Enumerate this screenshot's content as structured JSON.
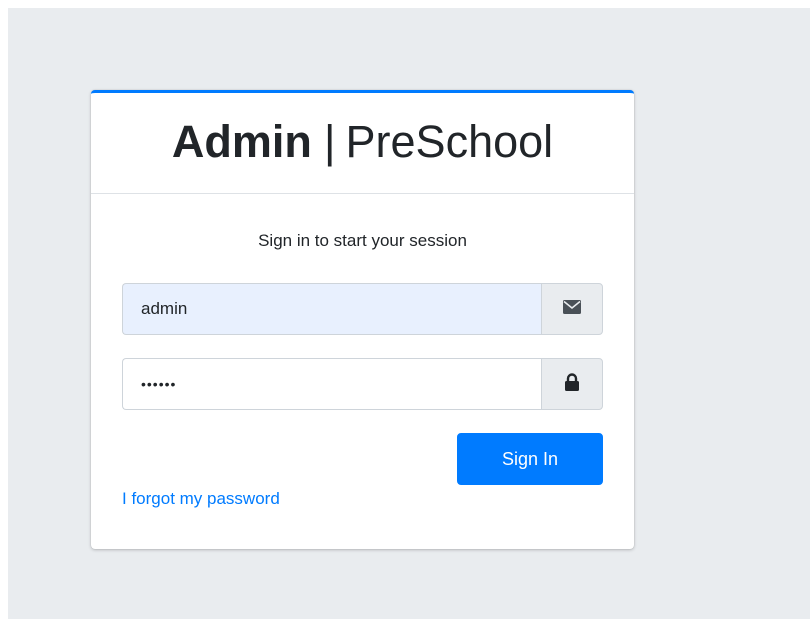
{
  "brand": {
    "bold": "Admin",
    "separator": "|",
    "light": "PreSchool"
  },
  "login": {
    "message": "Sign in to start your session",
    "email": {
      "value": "admin",
      "icon": "envelope-icon"
    },
    "password": {
      "value": "••••••",
      "icon": "lock-icon"
    },
    "signin_label": "Sign In",
    "forgot_label": "I forgot my password"
  },
  "colors": {
    "accent": "#007bff",
    "background": "#e9ecef",
    "autofill": "#e8f0fe"
  }
}
